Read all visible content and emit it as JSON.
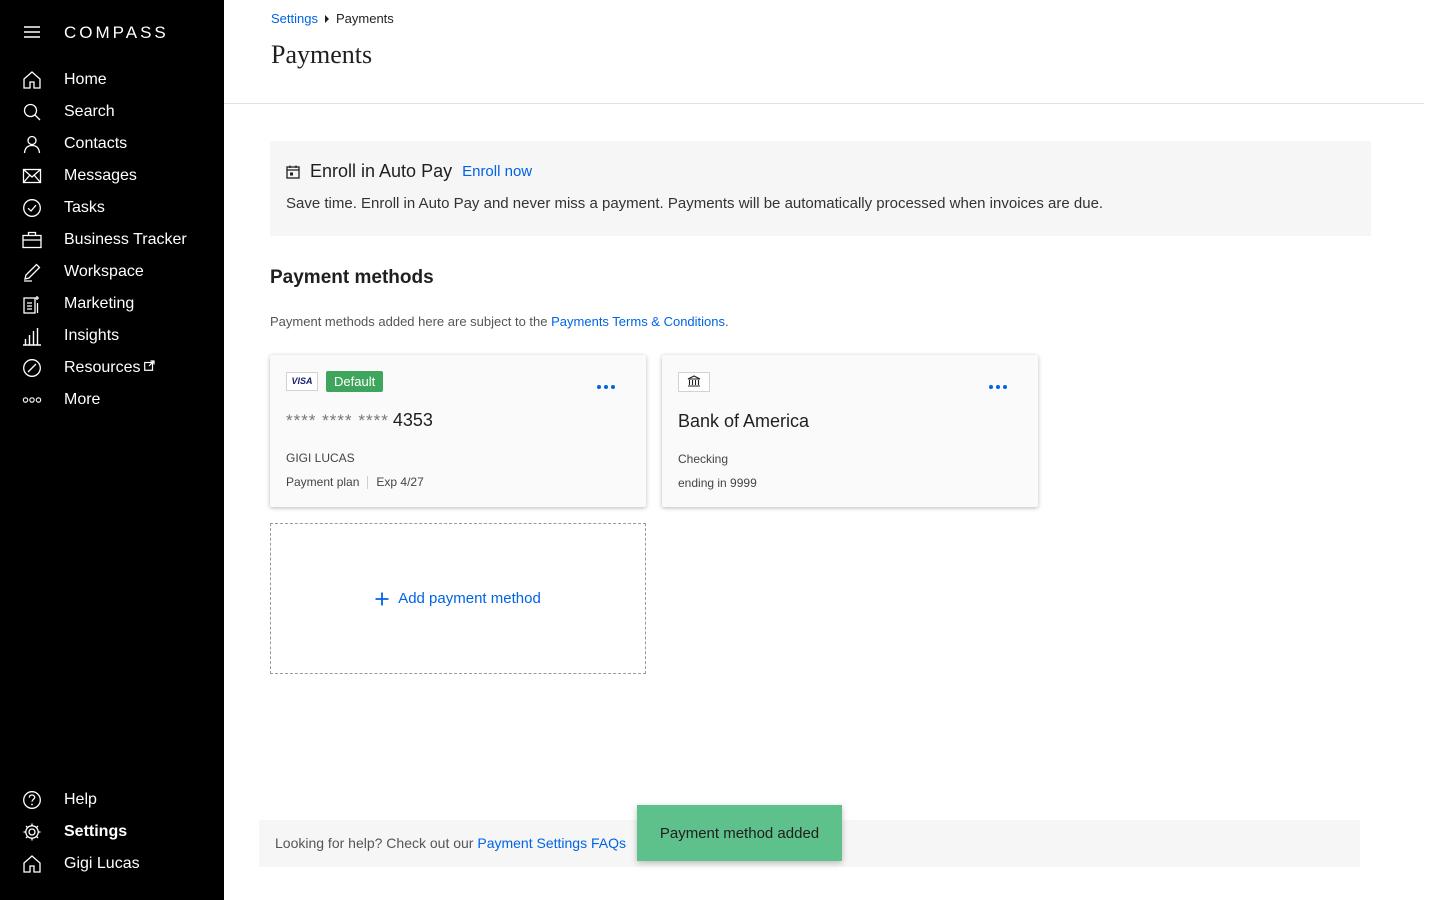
{
  "sidebar": {
    "logo": "COMPASS",
    "items": [
      {
        "label": "Home",
        "icon": "home-icon"
      },
      {
        "label": "Search",
        "icon": "search-icon"
      },
      {
        "label": "Contacts",
        "icon": "contacts-icon"
      },
      {
        "label": "Messages",
        "icon": "mail-icon"
      },
      {
        "label": "Tasks",
        "icon": "check-circle-icon"
      },
      {
        "label": "Business Tracker",
        "icon": "briefcase-icon"
      },
      {
        "label": "Workspace",
        "icon": "pencil-icon"
      },
      {
        "label": "Marketing",
        "icon": "marketing-icon"
      },
      {
        "label": "Insights",
        "icon": "bar-chart-icon"
      },
      {
        "label": "Resources",
        "icon": "compass-icon"
      },
      {
        "label": "More",
        "icon": "more-dots-icon"
      }
    ],
    "bottom": [
      {
        "label": "Help",
        "icon": "help-icon"
      },
      {
        "label": "Settings",
        "icon": "gear-icon"
      },
      {
        "label": "Gigi Lucas",
        "icon": "home-icon"
      }
    ]
  },
  "breadcrumb": {
    "parent": "Settings",
    "current": "Payments"
  },
  "page_title": "Payments",
  "autopay": {
    "title": "Enroll in Auto Pay",
    "link": "Enroll now",
    "description": "Save time. Enroll in Auto Pay and never miss a payment. Payments will be automatically processed when invoices are due."
  },
  "payment_methods": {
    "heading": "Payment methods",
    "subtitle_prefix": "Payment methods added here are subject to the ",
    "subtitle_link": "Payments Terms & Conditions",
    "subtitle_suffix": ".",
    "card": {
      "brand": "VISA",
      "badge": "Default",
      "mask": "**** **** ****",
      "last4": "4353",
      "holder": "GIGI LUCAS",
      "plan": "Payment plan",
      "exp": "Exp 4/27"
    },
    "bank": {
      "name": "Bank of America",
      "type": "Checking",
      "ending": "ending in 9999"
    },
    "add_label": "Add payment method"
  },
  "help": {
    "prefix": "Looking for help? Check out our ",
    "link": "Payment Settings FAQs"
  },
  "toast": "Payment method added",
  "colors": {
    "sidebar_bg": "#000000",
    "link": "#0064e5",
    "default_badge": "#3fa55d",
    "toast": "#5ec08a"
  }
}
